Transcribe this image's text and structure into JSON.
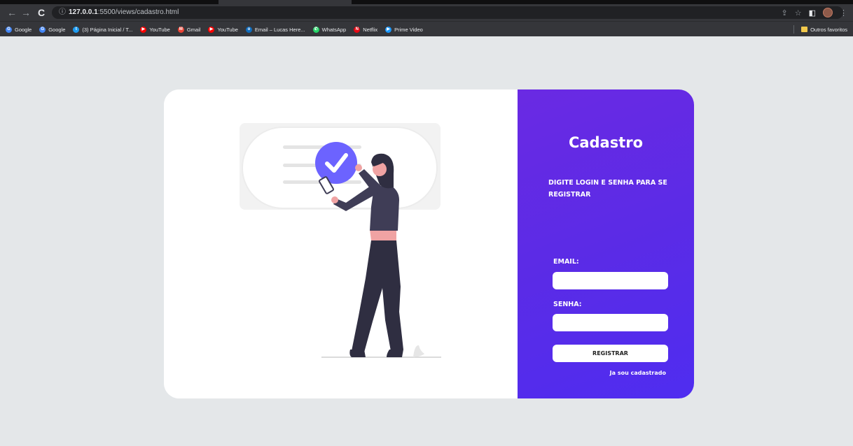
{
  "browser": {
    "url_host": "127.0.0.1",
    "url_rest": ":5500/views/cadastro.html",
    "info_icon": "ⓘ",
    "nav": {
      "back": "←",
      "forward": "→",
      "reload": "C"
    },
    "right_icons": {
      "share": "⇪",
      "star": "☆",
      "sidepanel": "◧",
      "menu": "⋮"
    },
    "bookmarks": [
      {
        "label": "Google",
        "icon": "google-icon",
        "color": "#4285f4",
        "glyph": "G"
      },
      {
        "label": "Google",
        "icon": "google-icon",
        "color": "#4285f4",
        "glyph": "G"
      },
      {
        "label": "(3) Página Inicial / T...",
        "icon": "twitter-icon",
        "color": "#1d9bf0",
        "glyph": "t"
      },
      {
        "label": "YouTube",
        "icon": "youtube-icon",
        "color": "#ff0000",
        "glyph": "▶"
      },
      {
        "label": "Gmail",
        "icon": "gmail-icon",
        "color": "#ea4335",
        "glyph": "M"
      },
      {
        "label": "YouTube",
        "icon": "youtube-icon",
        "color": "#ff0000",
        "glyph": "▶"
      },
      {
        "label": "Email – Lucas Here...",
        "icon": "outlook-icon",
        "color": "#0f6cbd",
        "glyph": "o"
      },
      {
        "label": "WhatsApp",
        "icon": "whatsapp-icon",
        "color": "#25d366",
        "glyph": "✆"
      },
      {
        "label": "Netflix",
        "icon": "netflix-icon",
        "color": "#e50914",
        "glyph": "N"
      },
      {
        "label": "Prime Video",
        "icon": "primevideo-icon",
        "color": "#1a98ff",
        "glyph": "▶"
      }
    ],
    "other_bookmarks": "Outros favoritos"
  },
  "form": {
    "title": "Cadastro",
    "subtitle": "DIGITE LOGIN E SENHA PARA SE REGISTRAR",
    "email_label": "EMAIL:",
    "email_value": "",
    "senha_label": "SENHA:",
    "senha_value": "",
    "submit_label": "REGISTRAR",
    "login_link": "Ja sou cadastrado"
  },
  "colors": {
    "accent_purple": "#5b2be6",
    "page_background": "#e4e7e9",
    "check_circle": "#6c63ff",
    "illustration_dark": "#2f2e41",
    "illustration_pink": "#f0a3a3"
  }
}
